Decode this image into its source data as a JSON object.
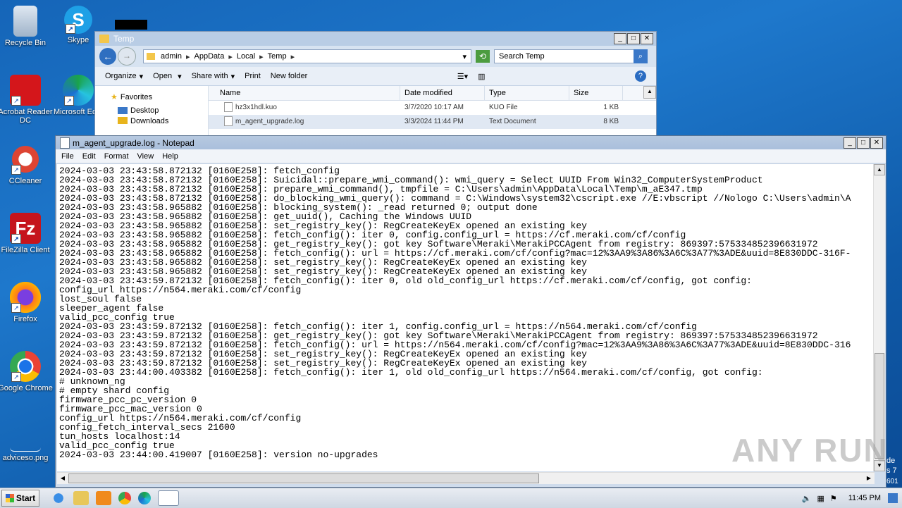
{
  "desktop": {
    "icons": [
      {
        "label": "Recycle Bin"
      },
      {
        "label": "Skype"
      },
      {
        "label": "Acrobat Reader DC"
      },
      {
        "label": "Microsoft Ed"
      },
      {
        "label": "CCleaner"
      },
      {
        "label": "FileZilla Client"
      },
      {
        "label": "Firefox"
      },
      {
        "label": "Google Chrome"
      },
      {
        "label": "adviceso.png"
      }
    ],
    "side_text": [
      "de",
      "s 7",
      "601"
    ],
    "watermark": "ANY RUN"
  },
  "explorer": {
    "title": "Temp",
    "breadcrumb": [
      "admin",
      "AppData",
      "Local",
      "Temp"
    ],
    "search_placeholder": "Search Temp",
    "toolbar": [
      "Organize",
      "Open",
      "Share with",
      "Print",
      "New folder"
    ],
    "nav": [
      "Favorites",
      "Desktop",
      "Downloads"
    ],
    "columns": [
      "Name",
      "Date modified",
      "Type",
      "Size"
    ],
    "rows": [
      {
        "name": "hz3x1hdl.kuo",
        "date": "3/7/2020 10:17 AM",
        "type": "KUO File",
        "size": "1 KB"
      },
      {
        "name": "m_agent_upgrade.log",
        "date": "3/3/2024 11:44 PM",
        "type": "Text Document",
        "size": "8 KB"
      }
    ]
  },
  "notepad": {
    "title": "m_agent_upgrade.log - Notepad",
    "menu": [
      "File",
      "Edit",
      "Format",
      "View",
      "Help"
    ],
    "lines": [
      "2024-03-03 23:43:58.872132 [0160E258]: fetch_config",
      "2024-03-03 23:43:58.872132 [0160E258]: Suicidal::prepare_wmi_command(): wmi_query = Select UUID From Win32_ComputerSystemProduct",
      "2024-03-03 23:43:58.872132 [0160E258]: prepare_wmi_command(), tmpfile = C:\\Users\\admin\\AppData\\Local\\Temp\\m_aE347.tmp",
      "2024-03-03 23:43:58.872132 [0160E258]: do_blocking_wmi_query(): command = C:\\Windows\\system32\\cscript.exe //E:vbscript //Nologo C:\\Users\\admin\\A",
      "2024-03-03 23:43:58.965882 [0160E258]: blocking_system(): _read returned 0; output done",
      "2024-03-03 23:43:58.965882 [0160E258]: get_uuid(), Caching the Windows UUID",
      "2024-03-03 23:43:58.965882 [0160E258]: set_registry_key(): RegCreateKeyEx opened an existing key",
      "2024-03-03 23:43:58.965882 [0160E258]: fetch_config(): iter 0, config.config_url = https://cf.meraki.com/cf/config",
      "2024-03-03 23:43:58.965882 [0160E258]: get_registry_key(): got key Software\\Meraki\\MerakiPCCAgent from registry: 869397:575334852396631972",
      "2024-03-03 23:43:58.965882 [0160E258]: fetch_config(): url = https://cf.meraki.com/cf/config?mac=12%3AA9%3A86%3A6C%3A77%3ADE&uuid=8E830DDC-316F-",
      "2024-03-03 23:43:58.965882 [0160E258]: set_registry_key(): RegCreateKeyEx opened an existing key",
      "2024-03-03 23:43:58.965882 [0160E258]: set_registry_key(): RegCreateKeyEx opened an existing key",
      "2024-03-03 23:43:59.872132 [0160E258]: fetch_config(): iter 0, old old_config_url https://cf.meraki.com/cf/config, got config:",
      "config_url https://n564.meraki.com/cf/config",
      "lost_soul false",
      "sleeper_agent false",
      "valid_pcc_config true",
      "2024-03-03 23:43:59.872132 [0160E258]: fetch_config(): iter 1, config.config_url = https://n564.meraki.com/cf/config",
      "2024-03-03 23:43:59.872132 [0160E258]: get_registry_key(): got key Software\\Meraki\\MerakiPCCAgent from registry: 869397:575334852396631972",
      "2024-03-03 23:43:59.872132 [0160E258]: fetch_config(): url = https://n564.meraki.com/cf/config?mac=12%3AA9%3A86%3A6C%3A77%3ADE&uuid=8E830DDC-316",
      "2024-03-03 23:43:59.872132 [0160E258]: set_registry_key(): RegCreateKeyEx opened an existing key",
      "2024-03-03 23:43:59.872132 [0160E258]: set_registry_key(): RegCreateKeyEx opened an existing key",
      "2024-03-03 23:44:00.403382 [0160E258]: fetch_config(): iter 1, old old_config_url https://n564.meraki.com/cf/config, got config:",
      "# unknown_ng",
      "# empty shard config",
      "firmware_pcc_pc_version 0",
      "firmware_pcc_mac_version 0",
      "config_url https://n564.meraki.com/cf/config",
      "config_fetch_interval_secs 21600",
      "tun_hosts localhost:14",
      "valid_pcc_config true",
      "2024-03-03 23:44:00.419007 [0160E258]: version no-upgrades"
    ]
  },
  "taskbar": {
    "start_label": "Start",
    "clock": "11:45 PM"
  }
}
